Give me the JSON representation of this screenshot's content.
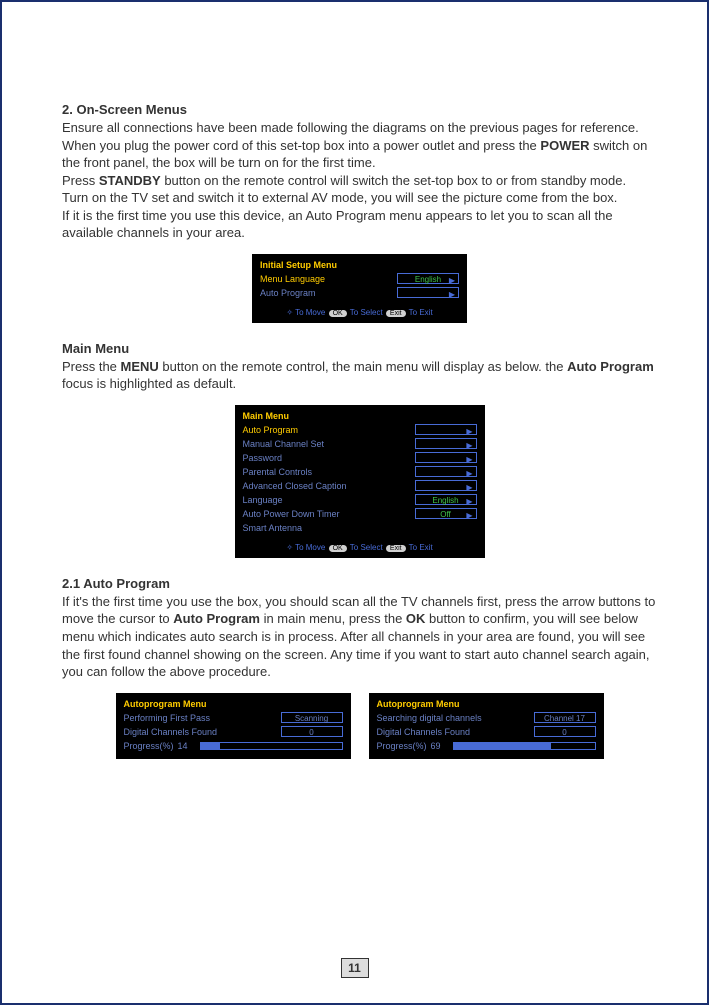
{
  "sec2": {
    "head": "2. On-Screen Menus",
    "p1a": "Ensure all connections have been made following the diagrams on the previous pages for reference.",
    "p1b_pre": "When you plug the power cord of this set-top box into a power outlet and press the ",
    "power": "POWER",
    "p1b_post": " switch on the front panel, the box will be turn on for the first time.",
    "p1c_pre": "Press ",
    "standby": "STANDBY",
    "p1c_post": " button on the remote control will switch the set-top box to or from standby mode.",
    "p1d": "Turn on the TV set and switch it to external AV mode, you will see the picture come from the box.",
    "p1e": "If it is the first time you use this device, an Auto Program menu appears to let you to scan all the available channels in your area."
  },
  "osd1": {
    "title": "Initial Setup Menu",
    "row1_label": "Menu Language",
    "row1_val": "English",
    "row2_label": "Auto Program",
    "footer_move": "To Move",
    "footer_ok": "OK",
    "footer_select": "To Select",
    "footer_exit": "Exit",
    "footer_exit2": "To Exit"
  },
  "mainmenu_sec": {
    "head": "Main Menu",
    "p_pre": "Press the ",
    "menu": "MENU",
    "p_mid": " button on the remote control, the main menu will display as below. the ",
    "auto": "Auto Program",
    "p_post": " focus is highlighted  as default."
  },
  "osd2": {
    "title": "Main Menu",
    "items": [
      {
        "label": "Auto Program",
        "val": "",
        "arrow": true
      },
      {
        "label": "Manual Channel Set",
        "val": "",
        "arrow": true
      },
      {
        "label": "Password",
        "val": "",
        "arrow": true
      },
      {
        "label": "Parental Controls",
        "val": "",
        "arrow": true
      },
      {
        "label": "Advanced Closed Caption",
        "val": "",
        "arrow": true
      },
      {
        "label": "Language",
        "val": "English",
        "arrow": true
      },
      {
        "label": "Auto Power Down Timer",
        "val": "Off",
        "arrow": true
      },
      {
        "label": "Smart Antenna",
        "val": "",
        "arrow": false
      }
    ],
    "footer_move": "To Move",
    "footer_ok": "OK",
    "footer_select": "To Select",
    "footer_exit": "Exit",
    "footer_exit2": "To Exit"
  },
  "sec21": {
    "head": "2.1 Auto Program",
    "p_pre": "If it's the first time you use the box, you should scan all the TV channels first, press the arrow buttons to move  the cursor to ",
    "auto": "Auto Program",
    "p_mid": "  in main menu, press the ",
    "ok": "OK",
    "p_post": " button  to confirm,  you will see below menu which indicates auto search is in process. After all channels in your area are found, you will see the first found channel showing on the screen. Any time if you want to start auto channel search again, you can follow the above procedure."
  },
  "osd3": {
    "title": "Autoprogram Menu",
    "r1": "Performing First Pass",
    "r1v": "Scanning",
    "r2": "Digital Channels Found",
    "r2v": "0",
    "r3": "Progress(%)",
    "r3v": "14",
    "fill": 14
  },
  "osd4": {
    "title": "Autoprogram Menu",
    "r1": "Searching digital channels",
    "r1v": "Channel 17",
    "r2": "Digital Channels Found",
    "r2v": "0",
    "r3": "Progress(%)",
    "r3v": "69",
    "fill": 69
  },
  "page_number": "11"
}
